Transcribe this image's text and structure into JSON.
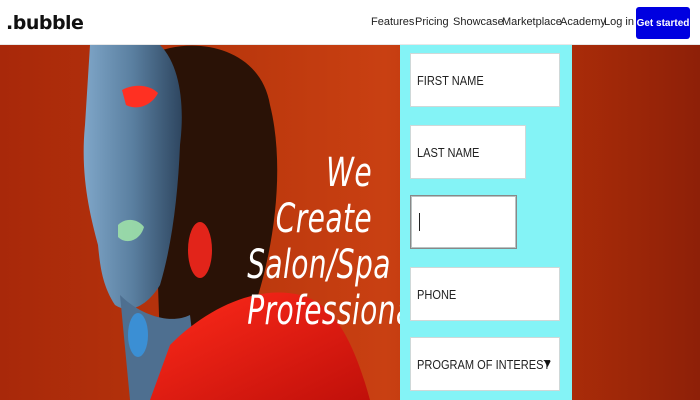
{
  "brand": {
    "logo_text": ".bubble"
  },
  "nav": {
    "links": [
      "Features",
      "Pricing",
      "Showcase",
      "Marketplace",
      "Academy",
      "Log in"
    ],
    "cta_label": "Get started"
  },
  "hero": {
    "title_lines": [
      "We Create",
      "Salon/Spa",
      "Professionals"
    ]
  },
  "form": {
    "first_name_placeholder": "FIRST NAME",
    "last_name_placeholder": "LAST NAME",
    "email_value": "",
    "phone_placeholder": "PHONE",
    "program_selected": "PROGRAM OF INTEREST"
  },
  "colors": {
    "cta_bg": "#0000e0",
    "form_panel_bg": "#84f3f6",
    "hero_bg": "#b8360c"
  }
}
